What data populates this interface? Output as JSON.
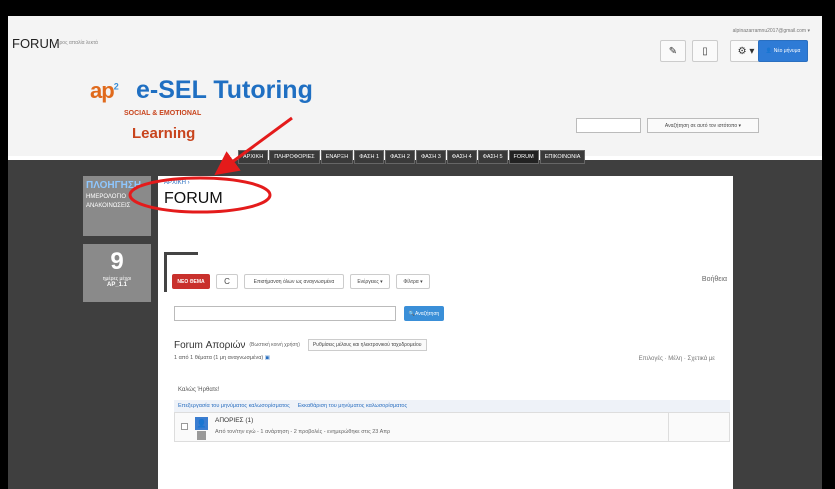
{
  "header": {
    "app_title": "FORUM",
    "app_subtitle": "προς απαλία λεκτά",
    "user_email": "alpinazarramnu2017@gmail.com ▾",
    "new_msg_label": "Νέο μήνυμα"
  },
  "logo": {
    "mark": "ap",
    "mark_sup": "2",
    "title": "e-SEL Tutoring",
    "sub1": "SOCIAL & EMOTIONAL",
    "sub2": "Learning"
  },
  "site_search": {
    "button_label": "Αναζήτηση σε αυτό τον ιστότοπο ▾"
  },
  "nav": {
    "items": [
      "ΑΡΧΙΚΗ",
      "ΠΛΗΡΟΦΟΡΙΕΣ",
      "ΕΝΑΡΞΗ",
      "ΦΑΣΗ 1",
      "ΦΑΣΗ 2",
      "ΦΑΣΗ 3",
      "ΦΑΣΗ 4",
      "ΦΑΣΗ 5",
      "FORUM",
      "ΕΠΙΚΟΙΝΩΝΙΑ"
    ]
  },
  "sidebar": {
    "title": "ΠΛΟΗΓΗΣΗ",
    "links": [
      "ΗΜΕΡΟΛΟΓΙΟ",
      "ΑΝΑΚΟΙΝΩΣΕΙΣ"
    ],
    "stat_num": "9",
    "stat_label": "ημέρες μέχρι",
    "stat_label2": "ΑΡ_1.1"
  },
  "main": {
    "breadcrumb": "ΑΡΧΙΚΗ ›",
    "title": "FORUM",
    "new_topic": "ΝΕΟ ΘΕΜΑ",
    "refresh": "C",
    "mark_read": "Επισήμανση όλων ως αναγνωσμένα",
    "actions": "Ενέργειες ▾",
    "filters": "Φίλτρα ▾",
    "help": "Βοήθεια",
    "search_button": "Αναζήτηση",
    "forum_name": "Forum Αποριών",
    "forum_desc": "(Βωστική κοινή χρήση)",
    "subscribe": "Ρυθμίσεις μέλους και ηλεκτρονικού ταχυδρομείου",
    "topic_count": "1 από 1 θέματα (1 μη αναγνωσμένα)",
    "sort": "Επιλογές · Μέλη · Σχετικά με",
    "welcome": "Καλώς Ήρθατε!",
    "link_a": "Επεξεργασία του μηνύματος καλωσορίσματος",
    "link_b": "Εκκαθάριση του μηνύματος καλωσορίσματος",
    "row_title": "ΑΠΟΡΙΕΣ (1)",
    "row_meta": "Από τον/την εγώ - 1 ανάρτηση - 2 προβολές - ενημερώθηκε στις 23 Απρ"
  }
}
